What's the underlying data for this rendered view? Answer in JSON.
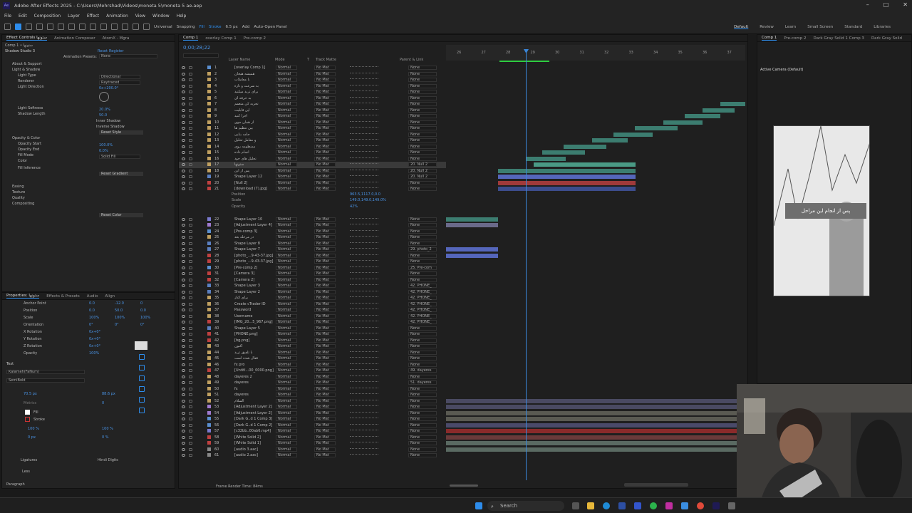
{
  "title": "Adobe After Effects 2025 - C:\\Users\\Mehrshad\\Videos\\moneta 5\\moneta 5 ae.aep",
  "menu": [
    "File",
    "Edit",
    "Composition",
    "Layer",
    "Effect",
    "Animation",
    "View",
    "Window",
    "Help"
  ],
  "toolbar": {
    "universal": "Universal",
    "snapping": "Snapping",
    "fill": "Fill",
    "stroke": "Stroke",
    "stroke_width": "6.5 px",
    "add": "Add",
    "auto_open": "Auto-Open Panel"
  },
  "workspaces": [
    "Default",
    "Review",
    "Learn",
    "Small Screen",
    "Standard",
    "Libraries"
  ],
  "left_panel": {
    "tabs": [
      "Effect Controls ستونها",
      "Animation Composer",
      "AtomX - Mgra"
    ],
    "path": "Comp 1 • ستونها",
    "effect": "Shadow Studio 3",
    "reset": "Reset",
    "register": "Register",
    "presets_label": "Animation Presets:",
    "presets_value": "None",
    "items": [
      "About & Support",
      "Light & Shadow",
      "Light Type",
      "Renderer",
      "Light Direction",
      "Light Softness",
      "Shadow Length",
      "Opacity & Color",
      "Opacity Start",
      "Opacity End",
      "Fill Mode",
      "Color",
      "Fill Inference",
      "Easing",
      "Texture",
      "Quality",
      "Compositing"
    ],
    "values": [
      "Directional",
      "Raytraced",
      "0x+200.0°",
      "20.0%",
      "50.0",
      "100.0%",
      "0.0%",
      "Solid Fill"
    ],
    "checks": [
      "Inner Shadow",
      "Inverse Shadow"
    ],
    "buttons": [
      "Reset Style",
      "Reset Gradient",
      "Reset Color"
    ]
  },
  "props_panel": {
    "tabs": [
      "Properties: ستونها",
      "Effects & Presets",
      "Audio",
      "Align"
    ],
    "rows": [
      "Anchor Point",
      "Position",
      "Scale",
      "Orientation",
      "X Rotation",
      "Y Rotation",
      "Z Rotation",
      "Opacity"
    ],
    "vals": [
      [
        "0.0",
        "-12.0",
        "0"
      ],
      [
        "0.0",
        "50.0",
        "0.0"
      ],
      [
        "100%",
        "100%",
        "100%"
      ],
      [
        "0°",
        "0°",
        "0°"
      ],
      [
        "0x+0°"
      ],
      [
        "0x+0°"
      ],
      [
        "0x+0°"
      ],
      [
        "100%"
      ]
    ],
    "text_head": "Text",
    "font": "Kalameh(FaNum)",
    "style": "SemiBold",
    "size": "70.5 px",
    "leading": "88.6 px",
    "metrics": "Metrics",
    "tracking": "0",
    "fill": "Fill",
    "stroke": "Stroke",
    "scale_v": "100 %",
    "scale_h": "100 %",
    "baseline": "0 px",
    "tsume": "0 %",
    "ligatures": "Ligatures",
    "hindi": "Hindi Digits",
    "less": "Less",
    "paragraph": "Paragraph"
  },
  "timeline": {
    "tabs": [
      "Comp 1",
      "overlay Comp 1",
      "Pre-comp 2"
    ],
    "timecode": "0;00;28;22",
    "headers": [
      "Layer Name",
      "Mode",
      "T",
      "Track Matte",
      "Parent & Link"
    ],
    "ruler": [
      "26",
      "27",
      "28",
      "29",
      "30",
      "31",
      "32",
      "33",
      "34",
      "35",
      "36",
      "37"
    ],
    "footer": "Frame Render Time: 84ms",
    "rows": [
      [
        "1",
        "[overlay Comp 1]",
        "#5a8fd0",
        "None"
      ],
      [
        "2",
        "همیشه هیجان",
        "#c0a060",
        "None"
      ],
      [
        "3",
        "با معاملات",
        "#c0a060",
        "None"
      ],
      [
        "4",
        "به سرعت و تازه",
        "#c0a060",
        "None"
      ],
      [
        "5",
        "برای ترید میکنید",
        "#c0a060",
        "None"
      ],
      [
        "6",
        "به حرفه ای",
        "#c0a060",
        "None"
      ],
      [
        "7",
        "تجزیه کن متعمم",
        "#c0a060",
        "None"
      ],
      [
        "8",
        "این قابلیت",
        "#c0a060",
        "None"
      ],
      [
        "9",
        "اجرا کنید",
        "#c0a060",
        "None"
      ],
      [
        "10",
        "از همان جوی",
        "#c0a060",
        "None"
      ],
      [
        "11",
        "بین تنظیم ها",
        "#c0a060",
        "None"
      ],
      [
        "12",
        "جامه بنایی",
        "#c0a060",
        "None"
      ],
      [
        "13",
        "و معامل تحلیل",
        "#c0a060",
        "None"
      ],
      [
        "14",
        "ممنظومه روی",
        "#c0a060",
        "None"
      ],
      [
        "15",
        "انجام داده",
        "#c0a060",
        "None"
      ],
      [
        "16",
        "تحلیل های خود",
        "#c0a060",
        "None"
      ],
      [
        "17",
        "ستونها",
        "#c0a060",
        "20. Null 2"
      ],
      [
        "18",
        "پس از این",
        "#c0a060",
        "20. Null 2"
      ],
      [
        "19",
        "Shape Layer 12",
        "#5a7fc0",
        "20. Null 2"
      ],
      [
        "20",
        "[Null 2]",
        "#c04040",
        "None"
      ],
      [
        "21",
        "[download (7).jpg]",
        "#c04040",
        "None"
      ],
      [
        "22",
        "Shape Layer 10",
        "#7a7ad0",
        "None"
      ],
      [
        "23",
        "[Adjustment Layer 4]",
        "#a07ad0",
        "None"
      ],
      [
        "24",
        "[Pre-comp 3]",
        "#5a8fd0",
        "None"
      ],
      [
        "25",
        "در مرحله بعد",
        "#c0a060",
        "None"
      ],
      [
        "26",
        "Shape Layer 8",
        "#5a7fc0",
        "None"
      ],
      [
        "27",
        "Shape Layer 7",
        "#5a7fc0",
        "29. photo_2"
      ],
      [
        "28",
        "[photo_...9-43-37.jpg]",
        "#c04040",
        "None"
      ],
      [
        "29",
        "[photo_...9-43-37.jpg]",
        "#c04040",
        "None"
      ],
      [
        "30",
        "[Pre-comp 2]",
        "#5a8fd0",
        "25. Pre-com"
      ],
      [
        "31",
        "[Camera 3]",
        "#c04040",
        "None"
      ],
      [
        "32",
        "[Camera 2]",
        "#c04040",
        "None"
      ],
      [
        "33",
        "Shape Layer 3",
        "#5a7fc0",
        "42. PHONE_"
      ],
      [
        "34",
        "Shape Layer 2",
        "#5a7fc0",
        "42. PHONE_"
      ],
      [
        "35",
        "برای آغاز",
        "#c0a060",
        "42. PHONE_"
      ],
      [
        "36",
        "Create cTrader ID",
        "#c0a060",
        "42. PHONE_"
      ],
      [
        "37",
        "Password",
        "#c0a060",
        "42. PHONE_"
      ],
      [
        "38",
        "Username",
        "#c0a060",
        "42. PHONE_"
      ],
      [
        "39",
        "[IMG_20...5_967.png]",
        "#c04040",
        "42. PHONE_"
      ],
      [
        "40",
        "Shape Layer 5",
        "#5a7fc0",
        "None"
      ],
      [
        "41",
        "[PHONE.png]",
        "#c04040",
        "None"
      ],
      [
        "42",
        "[bg.png]",
        "#c04040",
        "None"
      ],
      [
        "43",
        "اکنون",
        "#c0a060",
        "None"
      ],
      [
        "44",
        "با تلفیق ترید",
        "#c0a060",
        "None"
      ],
      [
        "45",
        "فعال شده است",
        "#c0a060",
        "None"
      ],
      [
        "46",
        "fx pro",
        "#c0a060",
        "None"
      ],
      [
        "47",
        "[Untitl...00_0000.png]",
        "#c04040",
        "49. dayeres"
      ],
      [
        "48",
        "dayeres 2",
        "#c0a060",
        "None"
      ],
      [
        "49",
        "dayeres",
        "#c0a060",
        "51. dayeres"
      ],
      [
        "50",
        "fx",
        "#c0a060",
        "None"
      ],
      [
        "51",
        "dayeres",
        "#c0a060",
        "None"
      ],
      [
        "52",
        "السلام",
        "#c0a060",
        "None"
      ],
      [
        "53",
        "[Adjustment Layer 2]",
        "#a07ad0",
        "None"
      ],
      [
        "54",
        "[Adjustment Layer 2]",
        "#a07ad0",
        "None"
      ],
      [
        "55",
        "[Dark G..d 1 Comp 3]",
        "#5a8fd0",
        "None"
      ],
      [
        "56",
        "[Dark G..d 1 Comp 2]",
        "#5a8fd0",
        "None"
      ],
      [
        "57",
        "[c32bb..00ab6.mp4]",
        "#7a7ad0",
        "None"
      ],
      [
        "58",
        "[White Solid 2]",
        "#c04040",
        "None"
      ],
      [
        "59",
        "[White Solid 1]",
        "#c04040",
        "None"
      ],
      [
        "60",
        "[audio 3.aac]",
        "#888888",
        "None"
      ],
      [
        "61",
        "[audio 2.aac]",
        "#888888",
        "None"
      ]
    ],
    "sub_props": [
      [
        "Position",
        "963.5,1117.0,0.0"
      ],
      [
        "Scale",
        "149.0,149.0,149.0%"
      ],
      [
        "Opacity",
        "42%"
      ]
    ],
    "mode": "Normal",
    "matte": "No Mat"
  },
  "comp": {
    "tabs": [
      "Comp 1",
      "Pre-comp 2",
      "Dark Gray Solid 1 Comp 3",
      "Dark Gray Solid"
    ],
    "camera": "Active Camera (Default)",
    "caption": "پس از انجام این مراحل"
  },
  "taskbar": {
    "search": "Search"
  }
}
